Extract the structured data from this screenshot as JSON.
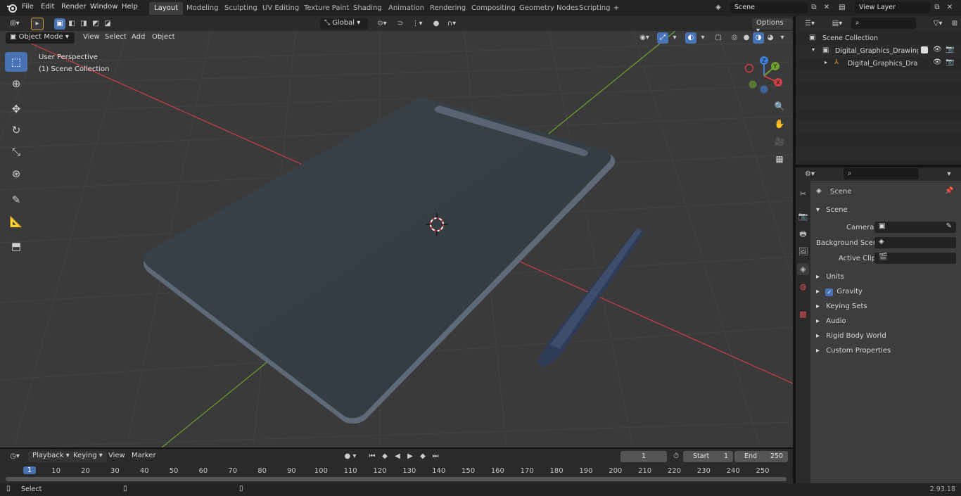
{
  "menu": [
    "File",
    "Edit",
    "Render",
    "Window",
    "Help"
  ],
  "workspaces": [
    "Layout",
    "Modeling",
    "Sculpting",
    "UV Editing",
    "Texture Paint",
    "Shading",
    "Animation",
    "Rendering",
    "Compositing",
    "Geometry Nodes",
    "Scripting"
  ],
  "active_workspace": "Layout",
  "scene_field": "Scene",
  "view_layer_field": "View Layer",
  "viewport_header": {
    "mode": "Object Mode",
    "menus": [
      "View",
      "Select",
      "Add",
      "Object"
    ],
    "transform_orientation": "Global",
    "options": "Options"
  },
  "viewport": {
    "perspective_label": "User Perspective",
    "collection_label": "(1) Scene Collection",
    "gizmo_axes": {
      "x": "X",
      "y": "Y",
      "z": "Z"
    }
  },
  "outliner": {
    "search_placeholder": "",
    "rows": [
      {
        "label": "Scene Collection"
      },
      {
        "label": "Digital_Graphics_Drawing_Tab"
      },
      {
        "label": "Digital_Graphics_Drawing"
      }
    ]
  },
  "properties": {
    "context": "Scene",
    "section": "Scene",
    "camera_label": "Camera",
    "background_scene_label": "Background Scene",
    "active_clip_label": "Active Clip",
    "panels": [
      "Units",
      "Gravity",
      "Keying Sets",
      "Audio",
      "Rigid Body World",
      "Custom Properties"
    ],
    "gravity_enabled": true
  },
  "timeline": {
    "menus": [
      "Playback",
      "Keying",
      "View",
      "Marker"
    ],
    "current_frame": "1",
    "start_label": "Start",
    "start": "1",
    "end_label": "End",
    "end": "250",
    "ticks": [
      "1",
      "10",
      "20",
      "30",
      "40",
      "50",
      "60",
      "70",
      "80",
      "90",
      "100",
      "110",
      "120",
      "130",
      "140",
      "150",
      "160",
      "170",
      "180",
      "190",
      "200",
      "210",
      "220",
      "230",
      "240",
      "250"
    ]
  },
  "statusbar": {
    "left": "Select",
    "version": "2.93.18"
  },
  "colors": {
    "accent": "#4772b3",
    "x_axis": "#cf3d47",
    "y_axis": "#6fa12f",
    "z_axis": "#3f7fd8"
  }
}
